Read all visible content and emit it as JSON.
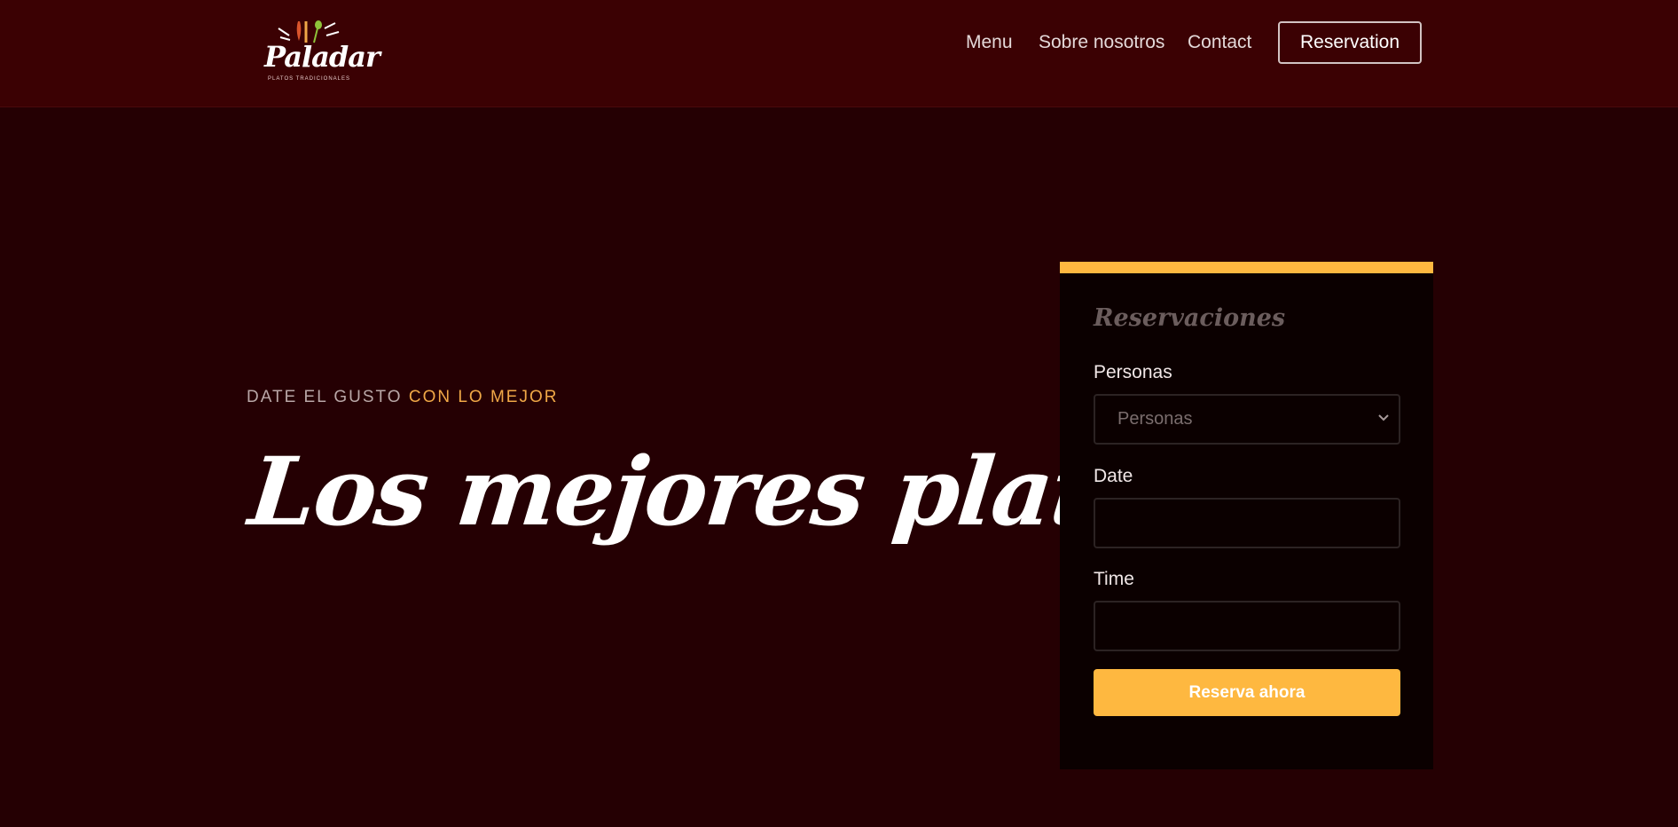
{
  "brand": {
    "name": "Paladar",
    "tagline": "PLATOS TRADICIONALES"
  },
  "nav": {
    "links": [
      "Menu",
      "Sobre nosotros",
      "Contact"
    ],
    "cta": "Reservation"
  },
  "hero": {
    "kicker_part1": "DATE EL GUSTO",
    "kicker_part2": "CON LO MEJOR",
    "title": "Los mejores platos!"
  },
  "reservation": {
    "title": "Reservaciones",
    "people_label": "Personas",
    "people_select_value": "Personas",
    "date_label": "Date",
    "date_value": "",
    "time_label": "Time",
    "time_value": "",
    "submit_label": "Reserva ahora"
  },
  "colors": {
    "accent": "#feb840",
    "kicker_highlight": "#f0a847",
    "navbar_bg": "#3b0103",
    "page_bg": "#250003",
    "card_bg": "#0b0000"
  },
  "icons": {
    "logo_utensils": "fork-knife-spoon-icon",
    "select_chevron": "chevron-down-icon"
  }
}
